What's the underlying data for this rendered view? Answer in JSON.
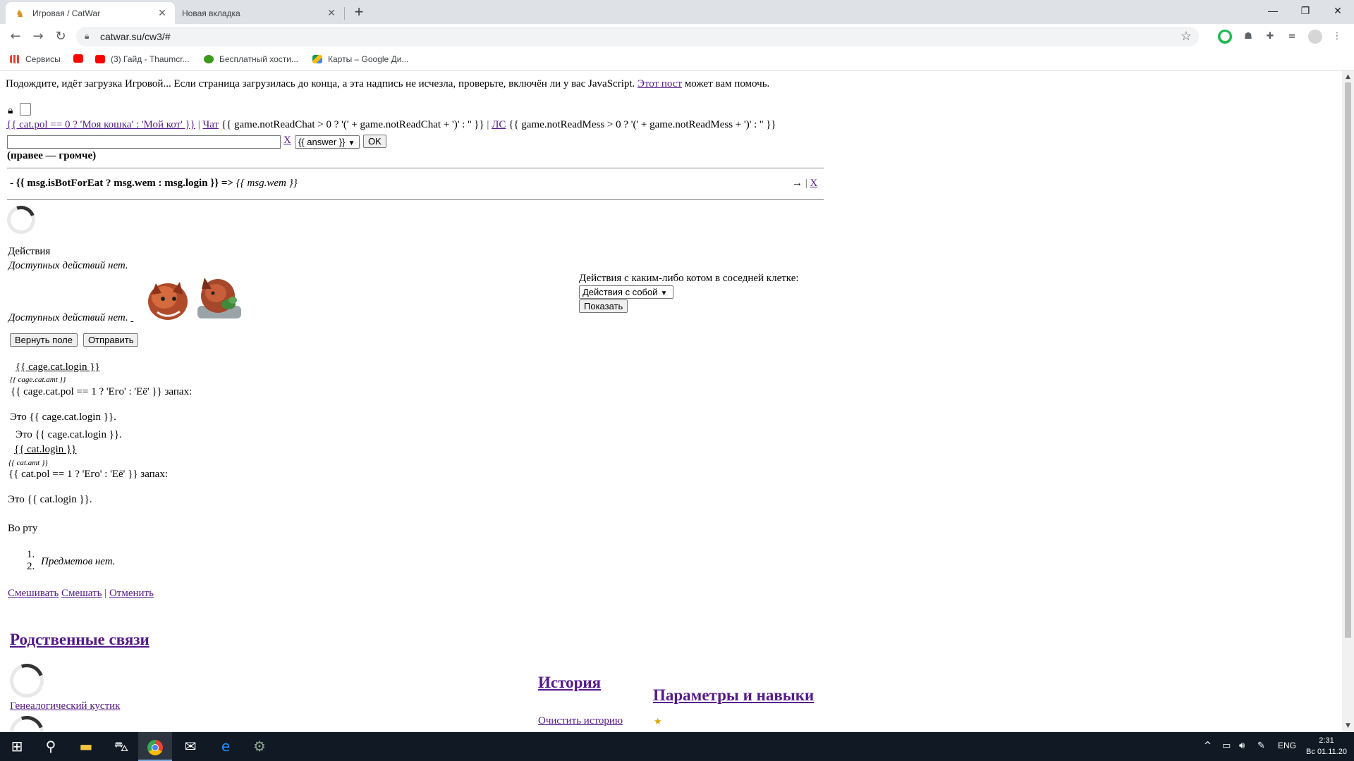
{
  "browser": {
    "tabs": [
      {
        "title": "Игровая / CatWar",
        "favicon": "catwar-favicon",
        "active": true
      },
      {
        "title": "Новая вкладка",
        "active": false
      }
    ],
    "new_tab": "+",
    "window": {
      "minimize": "—",
      "maximize": "❐",
      "close": "✕"
    },
    "nav": {
      "back": "←",
      "forward": "→",
      "reload": "↻"
    },
    "url": "catwar.su/cw3/#",
    "bookmarks": [
      {
        "label": "Сервисы",
        "icon": "apps-grid-icon",
        "color": "#ea4335"
      },
      {
        "label": "",
        "icon": "youtube-icon",
        "color": "#ff0000"
      },
      {
        "label": "(3) Гайд - Thaumcr...",
        "icon": "youtube-icon",
        "color": "#ff0000"
      },
      {
        "label": "Бесплатный хости...",
        "icon": "tree-icon",
        "color": "#3c9a1c"
      },
      {
        "label": "Карты – Google Ди...",
        "icon": "google-drive-icon",
        "color": "#fbbc04"
      }
    ]
  },
  "page": {
    "loading_text": "Подождите, идёт загрузка Игровой... Если страница загрузилась до конца, а эта надпись не исчезла, проверьте, включён ли у вас JavaScript.",
    "loading_link": "Этот пост",
    "loading_suffix": "может вам помочь.",
    "menu": {
      "cat_link": "{{ cat.pol == 0 ? 'Моя кошка' : 'Мой кот' }}",
      "chat_link": "Чат",
      "chat_count": "{{ game.notReadChat > 0 ? '(' + game.notReadChat + ')' : '' }}",
      "sep": "|",
      "ls_link": "ЛС",
      "ls_count": "{{ game.notReadMess > 0 ? '(' + game.notReadMess + ')' : '' }}"
    },
    "chat": {
      "clear_link": "X",
      "answer_select": "{{ answer }}",
      "ok_button": "OK",
      "hint": "(правее — громче)",
      "message_prefix": "-",
      "message_author": "{{ msg.isBotForEat ? msg.wem : msg.login }} =>",
      "message_target": "{{ msg.wem }}",
      "arrow": "→",
      "close_link": "X"
    },
    "actions": {
      "heading": "Действия",
      "none_1": "Доступных действий нет.",
      "none_2": "Доступных действий нет.",
      "return_button": "Вернуть поле",
      "send_button": "Отправить",
      "neighbor_label": "Действия с каким-либо котом в соседней клетке:",
      "neighbor_select": "Действия с собой",
      "show_button": "Показать"
    },
    "cage": {
      "login_link": "{{ cage.cat.login }}",
      "amt": "{{ cage.cat.amt }}",
      "smell": "{{ cage.cat.pol == 1 ? 'Его' : 'Её' }} запах:",
      "this_is": "Это {{ cage.cat.login }}.",
      "this_is_2": "Это {{ cage.cat.login }}."
    },
    "cat": {
      "login_link": "{{ cat.login }}",
      "amt": "{{ cat.amt }}",
      "smell": "{{ cat.pol == 1 ? 'Его' : 'Её' }} запах:",
      "this_is": "Это {{ cat.login }}."
    },
    "mouth": {
      "heading": "Во рту",
      "list_1": "1.",
      "list_2": "2.",
      "empty": "Предметов нет.",
      "mix_link": "Смешивать",
      "mix2_link": "Смешать",
      "sep": "|",
      "cancel_link": "Отменить"
    },
    "relatives": {
      "heading": "Родственные связи",
      "tree_link": "Генеалогический кустик"
    },
    "history": {
      "heading": "История",
      "clear_link": "Очистить историю"
    },
    "params": {
      "heading": "Параметры и навыки",
      "star": "★"
    }
  },
  "taskbar": {
    "start": "⊞",
    "search": "⚲",
    "tray_up": "^",
    "lang": "ENG",
    "time": "2:31",
    "date": "Вс 01.11.20"
  }
}
